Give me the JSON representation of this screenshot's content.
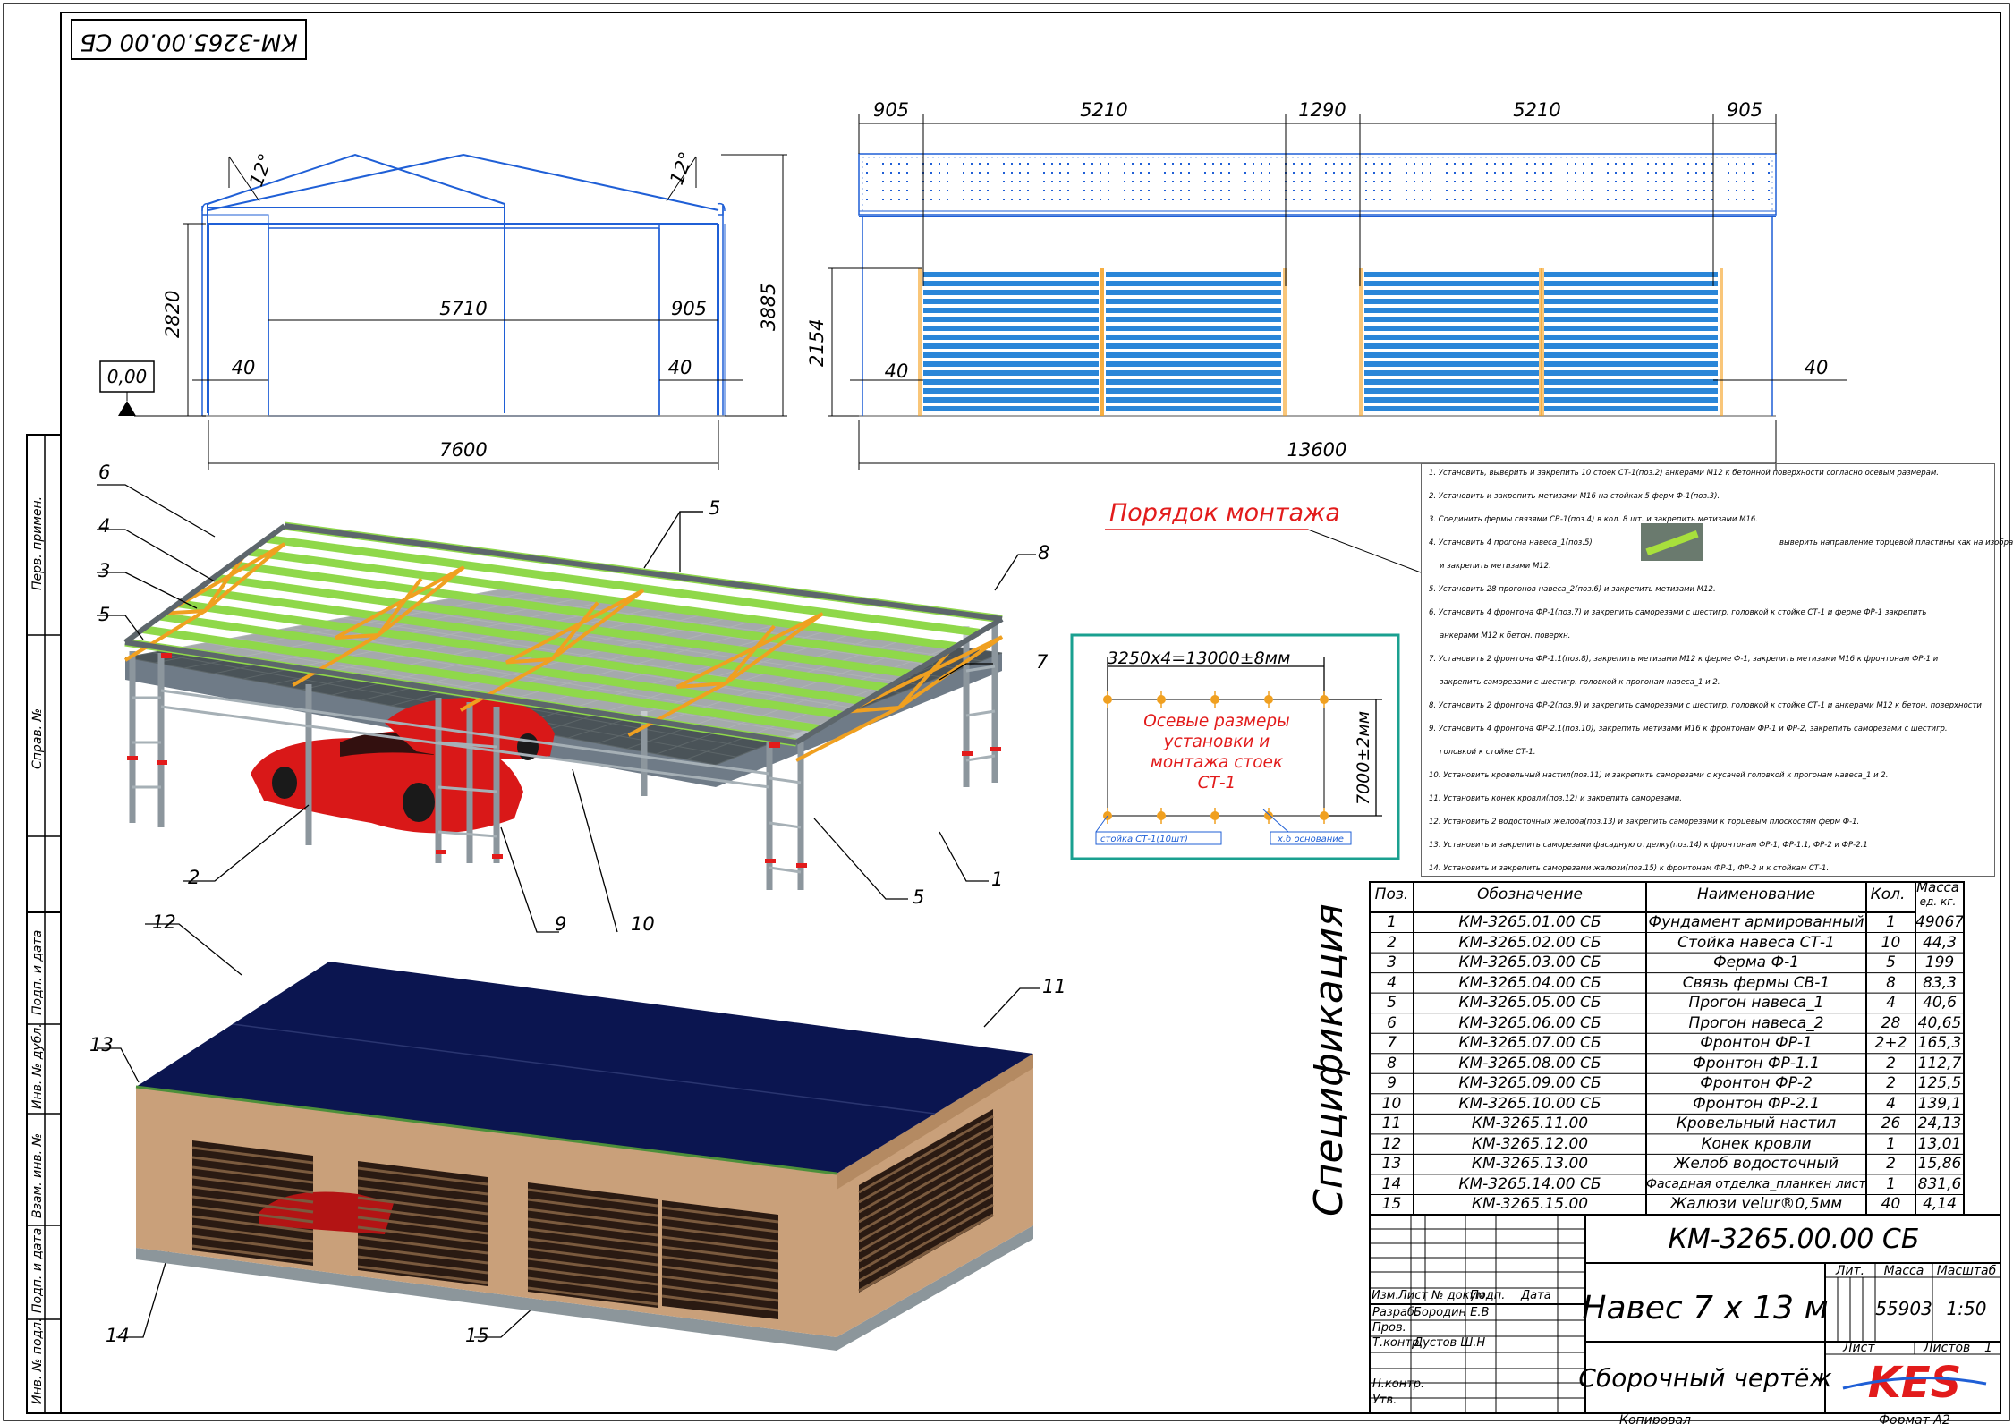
{
  "stamp_code": "КМ-3265.00.00 СБ",
  "elevation_label": "0,00",
  "dims_left": {
    "angle_left": "12°",
    "angle_right": "12°",
    "h_wall": "2820",
    "h_total": "3885",
    "w_inner": "5710",
    "w_side": "905",
    "off_left": "40",
    "off_right": "40",
    "w_total": "7600"
  },
  "dims_right": {
    "top": [
      "905",
      "5210",
      "1290",
      "5210",
      "905"
    ],
    "h_wall": "2154",
    "off_left": "40",
    "off_right": "40",
    "w_total": "13600"
  },
  "callouts": [
    "6",
    "4",
    "3",
    "5",
    "5",
    "8",
    "7",
    "2",
    "9",
    "10",
    "5",
    "1",
    "12",
    "11",
    "13",
    "14",
    "15"
  ],
  "montage_title": "Порядок монтажа",
  "axis_box": {
    "top_dim": "3250х4=13000±8мм",
    "right_dim": "7000±2мм",
    "center_text": "Осевые размеры установки и монтажа стоек СТ-1",
    "legend_left": "стойка СТ-1(10шт)",
    "legend_right": "х.б основание"
  },
  "notes": [
    "1. Установить, выверить и закрепить 10 стоек СТ-1(поз.2) анкерами М12 к бетонной поверхности согласно осевым размерам.",
    "2. Установить и закрепить метизами М16 на стойках 5 ферм Ф-1(поз.3).",
    "3. Соединить фермы связями СВ-1(поз.4) в кол. 8 шт. и закрепить метизами М16.",
    "4. Установить 4 прогона навеса_1(поз.5)",
    "и закрепить метизами М12.",
    "5. Установить 28 прогонов навеса_2(поз.6) и закрепить метизами М12.",
    "6. Установить 4 фронтона ФР-1(поз.7) и закрепить саморезами с шестигр. головкой к стойке СТ-1 и ферме ФР-1 закрепить",
    "анкерами М12 к бетон. поверхн.",
    "7. Установить 2 фронтона ФР-1.1(поз.8), закрепить метизами М12 к ферме Ф-1, закрепить метизами М16 к фронтонам ФР-1 и",
    "закрепить саморезами с шестигр. головкой к прогонам навеса_1 и 2.",
    "8. Установить 2 фронтона ФР-2(поз.9) и закрепить саморезами с шестигр. головкой к стойке СТ-1 и анкерами М12 к бетон. поверхности",
    "9. Установить 4 фронтона ФР-2.1(поз.10), закрепить метизами М16 к фронтонам ФР-1 и ФР-2, закрепить саморезами с шестигр.",
    "головкой к стойке СТ-1.",
    "10. Установить кровельный настил(поз.11) и закрепить саморезами с кусачей головкой к прогонам навеса_1 и 2.",
    "11. Установить конек кровли(поз.12) и закрепить саморезами.",
    "12. Установить 2 водосточных желоба(поз.13) и закрепить саморезами к торцевым плоскостям ферм Ф-1.",
    "13. Установить и закрепить саморезами фасадную отделку(поз.14) к фронтонам ФР-1, ФР-1.1, ФР-2 и ФР-2.1",
    "14. Установить и закрепить саморезами жалюзи(поз.15) к фронтонам ФР-1, ФР-2 и к стойкам СТ-1."
  ],
  "note4_right": "выверить направление торцевой пластины как на изображении",
  "spec_title": "Спецификация",
  "spec_headers": {
    "pos": "Поз.",
    "designation": "Обозначение",
    "name": "Наименование",
    "qty": "Кол.",
    "mass": "Масса",
    "mass_unit": "ед. кг."
  },
  "spec_rows": [
    {
      "pos": "1",
      "des": "КМ-3265.01.00 СБ",
      "name": "Фундамент армированный",
      "qty": "1",
      "mass": "49067"
    },
    {
      "pos": "2",
      "des": "КМ-3265.02.00 СБ",
      "name": "Стойка навеса СТ-1",
      "qty": "10",
      "mass": "44,3"
    },
    {
      "pos": "3",
      "des": "КМ-3265.03.00 СБ",
      "name": "Ферма Ф-1",
      "qty": "5",
      "mass": "199"
    },
    {
      "pos": "4",
      "des": "КМ-3265.04.00 СБ",
      "name": "Связь фермы СВ-1",
      "qty": "8",
      "mass": "83,3"
    },
    {
      "pos": "5",
      "des": "КМ-3265.05.00 СБ",
      "name": "Прогон навеса_1",
      "qty": "4",
      "mass": "40,6"
    },
    {
      "pos": "6",
      "des": "КМ-3265.06.00 СБ",
      "name": "Прогон навеса_2",
      "qty": "28",
      "mass": "40,65"
    },
    {
      "pos": "7",
      "des": "КМ-3265.07.00 СБ",
      "name": "Фронтон ФР-1",
      "qty": "2+2",
      "mass": "165,3"
    },
    {
      "pos": "8",
      "des": "КМ-3265.08.00 СБ",
      "name": "Фронтон ФР-1.1",
      "qty": "2",
      "mass": "112,7"
    },
    {
      "pos": "9",
      "des": "КМ-3265.09.00 СБ",
      "name": "Фронтон ФР-2",
      "qty": "2",
      "mass": "125,5"
    },
    {
      "pos": "10",
      "des": "КМ-3265.10.00 СБ",
      "name": "Фронтон ФР-2.1",
      "qty": "4",
      "mass": "139,1"
    },
    {
      "pos": "11",
      "des": "КМ-3265.11.00",
      "name": "Кровельный настил",
      "qty": "26",
      "mass": "24,13"
    },
    {
      "pos": "12",
      "des": "КМ-3265.12.00",
      "name": "Конек кровли",
      "qty": "1",
      "mass": "13,01"
    },
    {
      "pos": "13",
      "des": "КМ-3265.13.00",
      "name": "Желоб водосточный",
      "qty": "2",
      "mass": "15,86"
    },
    {
      "pos": "14",
      "des": "КМ-3265.14.00 СБ",
      "name": "Фасадная отделка_планкен лиственница",
      "qty": "1",
      "mass": "831,6"
    },
    {
      "pos": "15",
      "des": "КМ-3265.15.00",
      "name": "Жалюзи velur®0,5мм",
      "qty": "40",
      "mass": "4,14"
    }
  ],
  "title_block": {
    "code": "КМ-3265.00.00 СБ",
    "name": "Навес 7 х 13 м",
    "doc_type": "Сборочный чертёж",
    "lit_label": "Лит.",
    "mass_label": "Масса",
    "scale_label": "Масштаб",
    "mass": "55903",
    "scale": "1:50",
    "sheet_label": "Лист",
    "sheets_label": "Листов",
    "sheets": "1",
    "col_labels": [
      "Изм.",
      "Лист",
      "№ докум.",
      "Подп.",
      "Дата"
    ],
    "rows": [
      {
        "role": "Разраб.",
        "person": "Бородин Е.В"
      },
      {
        "role": "Пров.",
        "person": ""
      },
      {
        "role": "Т.контр.",
        "person": "Дустов Ш.Н"
      },
      {
        "role": "",
        "person": ""
      },
      {
        "role": "Н.контр.",
        "person": ""
      },
      {
        "role": "Утв.",
        "person": ""
      }
    ],
    "logo": "KES",
    "copied": "Копировал",
    "format": "Формат   А2"
  },
  "side_stamp": [
    "Перв. примен.",
    "Справ. №",
    "Подп. и дата",
    "Инв. № дубл.",
    "Взам. инв. №",
    "Подп. и дата",
    "Инв. № подл."
  ],
  "colors": {
    "blue_line": "#1f5fd6",
    "louver": "#2a86d8",
    "red": "#e21b1b",
    "roof_green": "#9ddb4a",
    "truss_orange": "#f0a020",
    "roof_dark": "#0b1550",
    "wood": "#c9a07a",
    "teal": "#1aa090"
  }
}
